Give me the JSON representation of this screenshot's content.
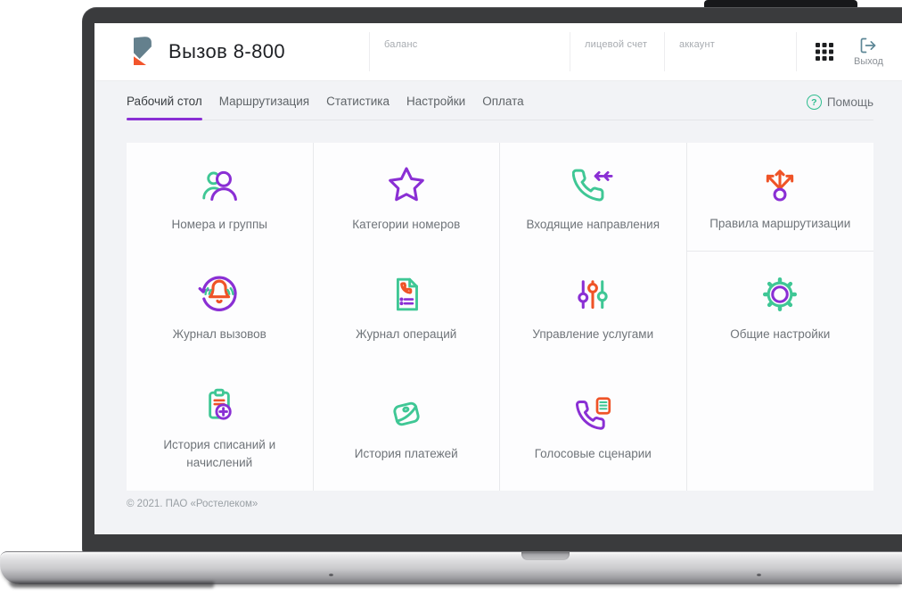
{
  "brand": {
    "title": "Вызов 8-800"
  },
  "header": {
    "fields": [
      {
        "label": "баланс"
      },
      {
        "label": "лицевой счет"
      },
      {
        "label": "аккаунт"
      }
    ],
    "logout_label": "Выход"
  },
  "nav": {
    "tabs": [
      {
        "label": "Рабочий стол",
        "active": true
      },
      {
        "label": "Маршрутизация",
        "active": false
      },
      {
        "label": "Статистика",
        "active": false
      },
      {
        "label": "Настройки",
        "active": false
      },
      {
        "label": "Оплата",
        "active": false
      }
    ],
    "help_label": "Помощь",
    "help_glyph": "?"
  },
  "tiles": [
    {
      "label": "Номера и группы",
      "icon": "users-icon"
    },
    {
      "label": "Категории номеров",
      "icon": "star-icon"
    },
    {
      "label": "Входящие направления",
      "icon": "incoming-call-icon"
    },
    {
      "label": "Правила маршрутизации",
      "icon": "route-branch-icon"
    },
    {
      "label": "Журнал вызовов",
      "icon": "call-history-icon"
    },
    {
      "label": "Журнал операций",
      "icon": "operations-document-icon"
    },
    {
      "label": "Управление услугами",
      "icon": "sliders-icon"
    },
    {
      "label": "Общие настройки",
      "icon": "gear-icon"
    },
    {
      "label": "История списаний и начислений",
      "icon": "clipboard-plus-icon"
    },
    {
      "label": "История платежей",
      "icon": "wallet-icon"
    },
    {
      "label": "Голосовые сценарии",
      "icon": "voice-script-icon"
    }
  ],
  "footer": {
    "copyright": "© 2021. ПАО «Ростелеком»"
  },
  "colors": {
    "accent_purple": "#8a2fd4",
    "accent_green": "#3fc795",
    "accent_orange": "#ef5327",
    "logo_slate": "#64808d",
    "logo_orange": "#f2552c",
    "exit_icon": "#5d8796",
    "help_green": "#2fbd8f"
  }
}
